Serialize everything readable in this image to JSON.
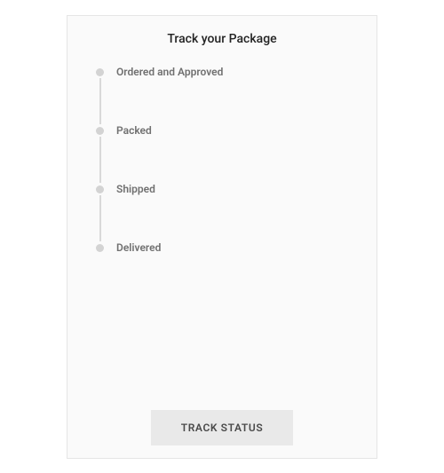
{
  "title": "Track your Package",
  "steps": [
    {
      "label": "Ordered and Approved"
    },
    {
      "label": "Packed"
    },
    {
      "label": "Shipped"
    },
    {
      "label": "Delivered"
    }
  ],
  "button": {
    "label": "TRACK STATUS"
  }
}
